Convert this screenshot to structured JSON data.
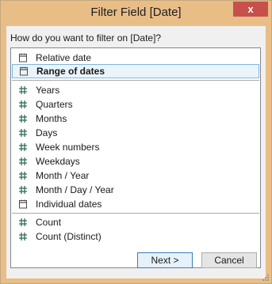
{
  "window": {
    "title": "Filter Field [Date]",
    "close_glyph": "x"
  },
  "prompt": "How do you want to filter on [Date]?",
  "items": [
    {
      "label": "Relative date",
      "icon": "calendar-icon"
    },
    {
      "label": "Range of dates",
      "icon": "calendar-icon",
      "selected": true
    },
    {
      "label": "Years",
      "icon": "hash-icon"
    },
    {
      "label": "Quarters",
      "icon": "hash-icon"
    },
    {
      "label": "Months",
      "icon": "hash-icon"
    },
    {
      "label": "Days",
      "icon": "hash-icon"
    },
    {
      "label": "Week numbers",
      "icon": "hash-icon"
    },
    {
      "label": "Weekdays",
      "icon": "hash-icon"
    },
    {
      "label": "Month / Year",
      "icon": "hash-icon"
    },
    {
      "label": "Month / Day / Year",
      "icon": "hash-icon"
    },
    {
      "label": "Individual dates",
      "icon": "calendar-icon"
    },
    {
      "label": "Count",
      "icon": "hash-icon"
    },
    {
      "label": "Count (Distinct)",
      "icon": "hash-icon"
    }
  ],
  "buttons": {
    "next": "Next >",
    "cancel": "Cancel"
  },
  "colors": {
    "title_bar": "#e9bd86",
    "close": "#c7504b",
    "selection": "#7fb6de",
    "hash_icon": "#2f6b55",
    "calendar_icon": "#4a4a4a"
  }
}
